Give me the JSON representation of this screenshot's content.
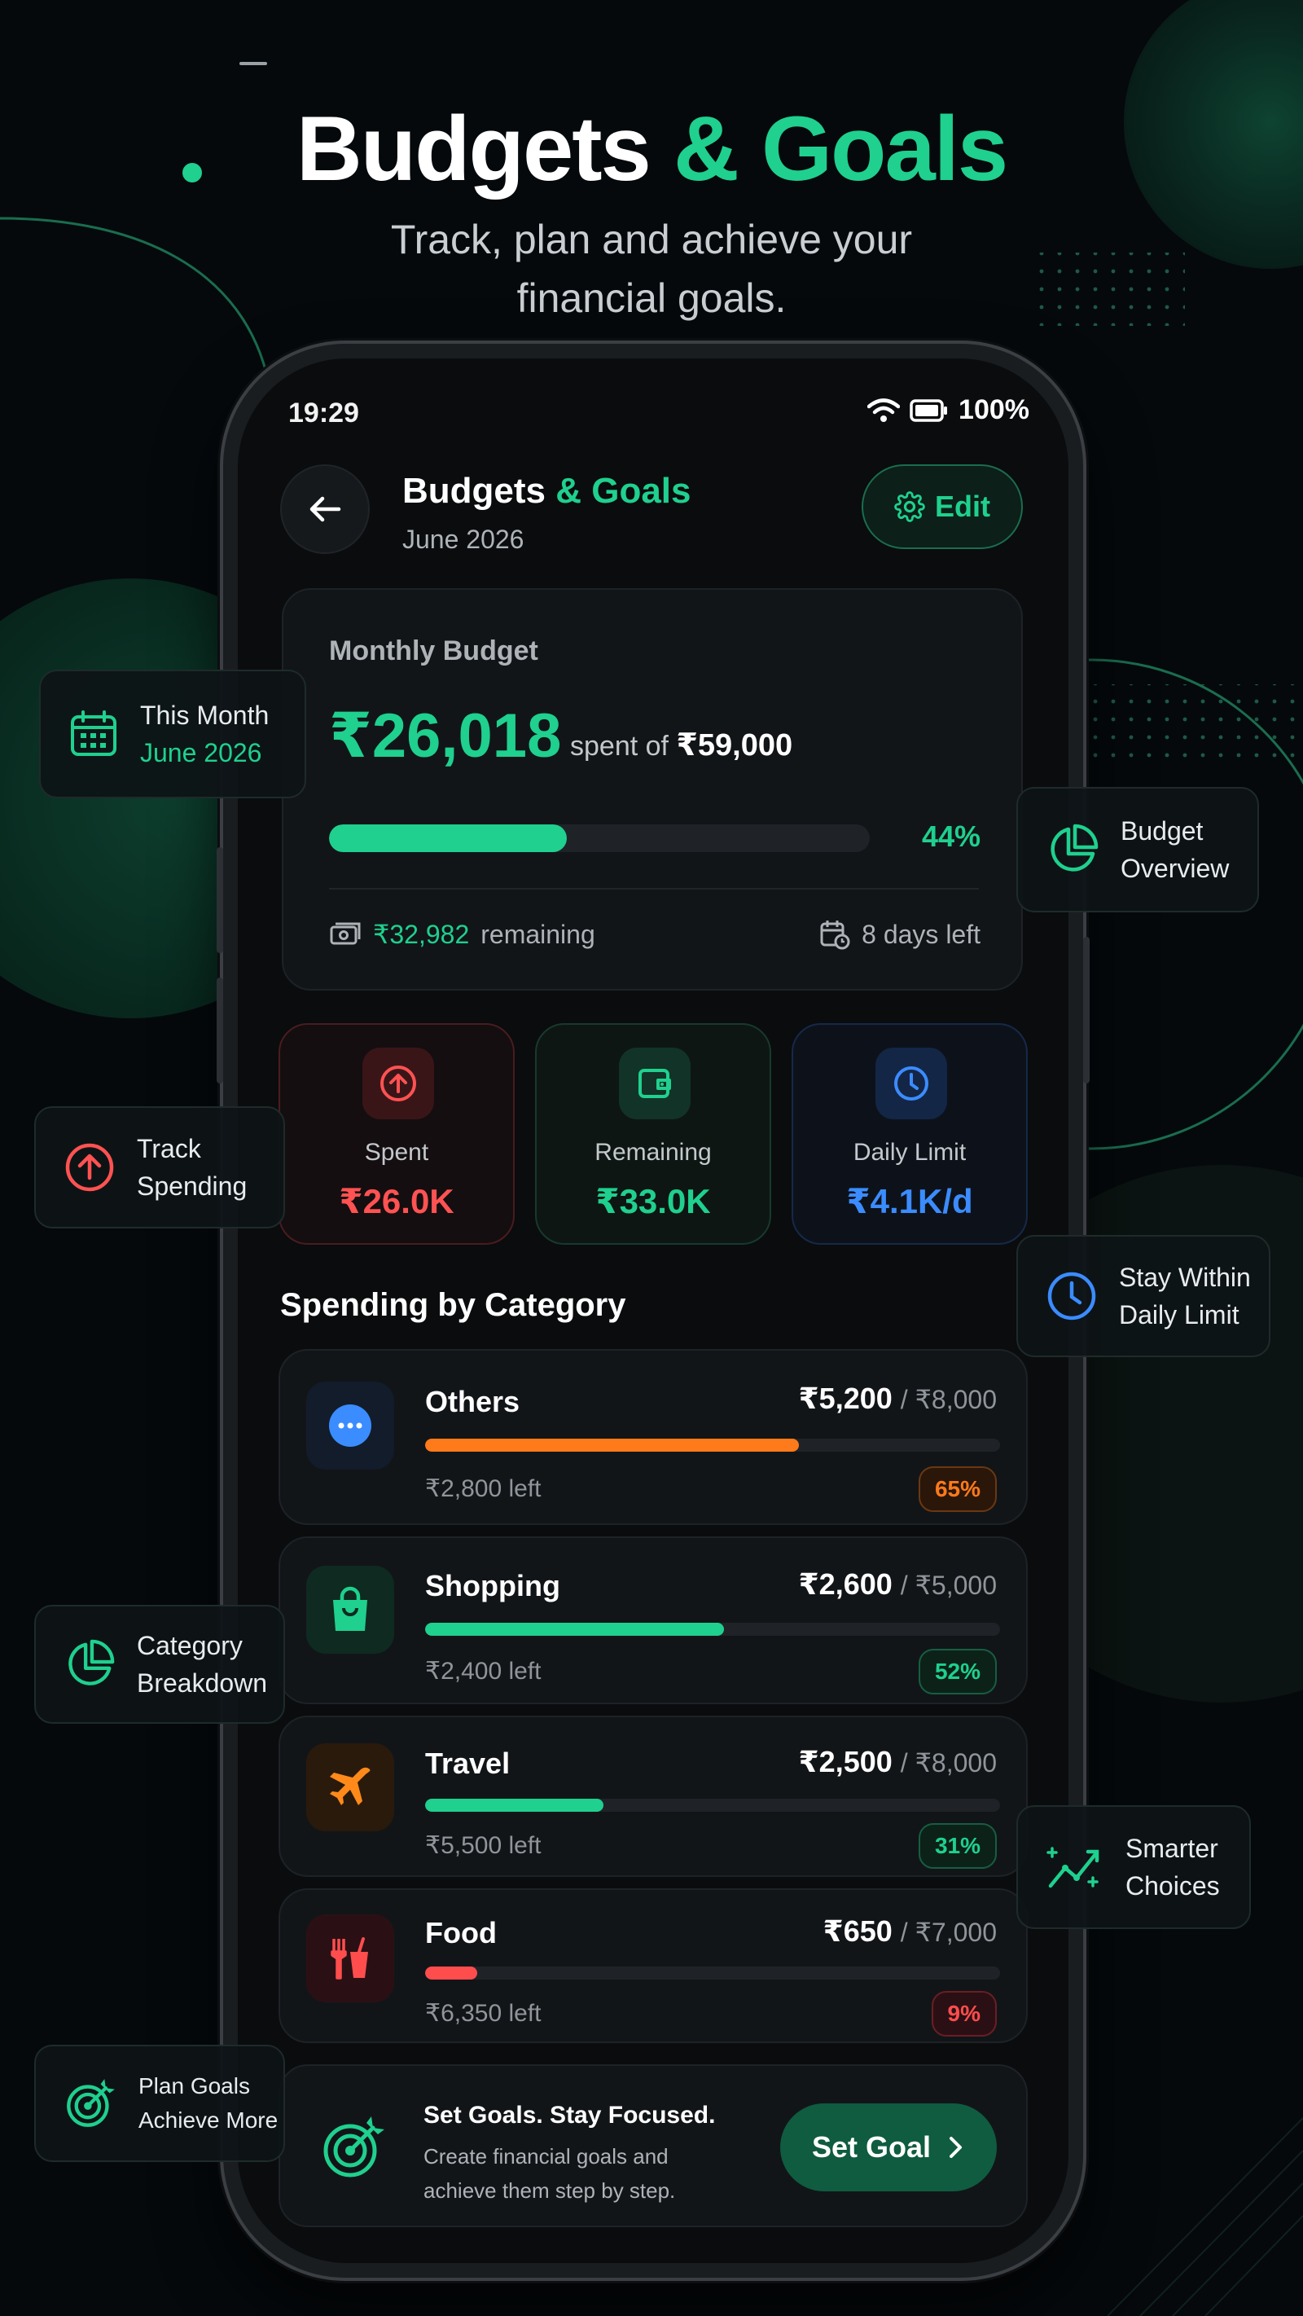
{
  "hero": {
    "title_main": "Budgets",
    "title_accent": "& Goals",
    "subtitle_line1": "Track, plan and achieve your",
    "subtitle_line2": "financial goals."
  },
  "status_bar": {
    "time": "19:29",
    "battery": "100%"
  },
  "header": {
    "title_main": "Budgets",
    "title_accent": "& Goals",
    "subtitle": "June 2026",
    "edit_label": "Edit"
  },
  "monthly_budget": {
    "label": "Monthly Budget",
    "spent": "₹26,018",
    "of_text": "spent of",
    "total": "₹59,000",
    "progress": 0.44,
    "percent_label": "44%",
    "remaining_amount": "₹32,982",
    "remaining_text": "remaining",
    "days_left": "8 days left"
  },
  "stats": [
    {
      "label": "Spent",
      "value": "₹26.0K",
      "color": "#ff5252"
    },
    {
      "label": "Remaining",
      "value": "₹33.0K",
      "color": "#1fd08e"
    },
    {
      "label": "Daily Limit",
      "value": "₹4.1K/d",
      "color": "#3b8cff"
    }
  ],
  "spending_title": "Spending by Category",
  "categories": [
    {
      "name": "Others",
      "spent": "₹5,200",
      "limit": "/ ₹8,000",
      "left": "₹2,800 left",
      "percent_label": "65%",
      "progress": 0.65,
      "color": "#ff7a1a",
      "icon": "more-icon"
    },
    {
      "name": "Shopping",
      "spent": "₹2,600",
      "limit": "/ ₹5,000",
      "left": "₹2,400 left",
      "percent_label": "52%",
      "progress": 0.52,
      "color": "#1fd08e",
      "icon": "shopping-bag-icon"
    },
    {
      "name": "Travel",
      "spent": "₹2,500",
      "limit": "/ ₹8,000",
      "left": "₹5,500 left",
      "percent_label": "31%",
      "progress": 0.31,
      "color": "#1fd08e",
      "icon": "airplane-icon"
    },
    {
      "name": "Food",
      "spent": "₹650",
      "limit": "/ ₹7,000",
      "left": "₹6,350 left",
      "percent_label": "9%",
      "progress": 0.09,
      "color": "#ff4d4d",
      "icon": "food-icon"
    }
  ],
  "goal": {
    "title": "Set Goals. Stay Focused.",
    "desc_line1": "Create financial goals and",
    "desc_line2": "achieve them step by step.",
    "button": "Set Goal"
  },
  "chips": {
    "this_month": {
      "line1": "This Month",
      "line2": "June 2026"
    },
    "budget_overview": {
      "line1": "Budget",
      "line2": "Overview"
    },
    "track_spending": {
      "line1": "Track",
      "line2": "Spending"
    },
    "daily_limit": {
      "line1": "Stay Within",
      "line2": "Daily Limit"
    },
    "category_breakdown": {
      "line1": "Category",
      "line2": "Breakdown"
    },
    "smarter_choices": {
      "line1": "Smarter",
      "line2": "Choices"
    },
    "plan_goals": {
      "line1": "Plan Goals",
      "line2": "Achieve More"
    }
  }
}
